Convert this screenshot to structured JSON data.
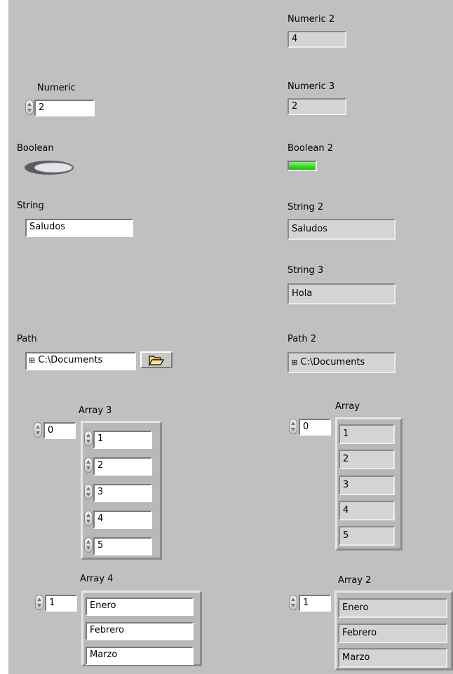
{
  "numeric": {
    "label": "Numeric",
    "value": "2"
  },
  "numeric2": {
    "label": "Numeric 2",
    "value": "4"
  },
  "numeric3": {
    "label": "Numeric 3",
    "value": "2"
  },
  "boolean": {
    "label": "Boolean"
  },
  "boolean2": {
    "label": "Boolean 2",
    "led_color": "#33dd22"
  },
  "string": {
    "label": "String",
    "value": "Saludos"
  },
  "string2": {
    "label": "String 2",
    "value": "Saludos"
  },
  "string3": {
    "label": "String 3",
    "value": "Hola"
  },
  "path": {
    "label": "Path",
    "value": "C:\\Documents"
  },
  "path2": {
    "label": "Path 2",
    "value": "C:\\Documents"
  },
  "array3": {
    "label": "Array 3",
    "index": "0",
    "items": [
      "1",
      "2",
      "3",
      "4",
      "5"
    ]
  },
  "array": {
    "label": "Array",
    "index": "0",
    "items": [
      "1",
      "2",
      "3",
      "4",
      "5"
    ]
  },
  "array4": {
    "label": "Array 4",
    "index": "1",
    "items": [
      "Enero",
      "Febrero",
      "Marzo"
    ]
  },
  "array2": {
    "label": "Array 2",
    "index": "1",
    "items": [
      "Enero",
      "Febrero",
      "Marzo"
    ]
  }
}
